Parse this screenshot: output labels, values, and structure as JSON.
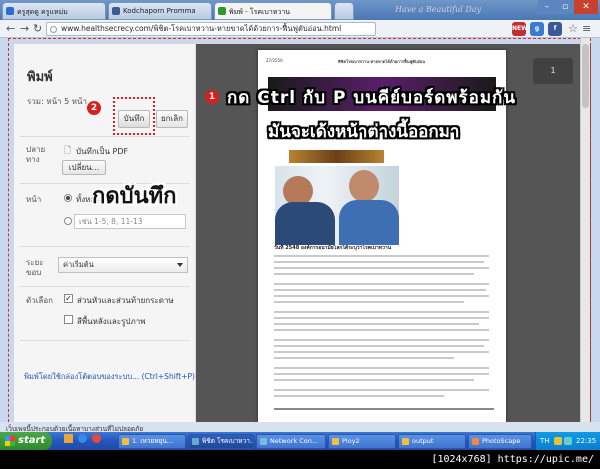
{
  "browser": {
    "tabs": [
      {
        "label": "ครูสุดดู ครูแหม่ม"
      },
      {
        "label": "Kodchaporn Promma"
      },
      {
        "label": "พิมพ์ - โรคเบาหวาน"
      }
    ],
    "deco_text": "Have a Beautiful Day",
    "url": "www.healthsecrecy.com/พิชิต-โรคเบาหวาน-หายขาดได้ด้วยการ-ฟื้นฟูตับอ่อน.html",
    "ext_icons": [
      "NEW",
      "g",
      "f"
    ],
    "colors": {
      "accent": "#d81f1f",
      "link": "#2255bb"
    }
  },
  "print": {
    "title": "พิมพ์",
    "total_label": "รวม:",
    "total_value": "หน้า 5 หน้า",
    "save_button": "บันทึก",
    "cancel_button": "ยกเลิก",
    "destination_label": "ปลายทาง",
    "destination_value": "บันทึกเป็น PDF",
    "change_button": "เปลี่ยน...",
    "pages_label": "หน้า",
    "pages_all": "ทั้งหมด",
    "pages_placeholder": "เช่น 1-5, 8, 11-13",
    "margins_label": "ระยะขอบ",
    "margins_value": "ค่าเริ่มต้น",
    "options_label": "ตัวเลือก",
    "option_headers": "ส่วนหัวและส่วนท้ายกระดาษ",
    "option_bg": "สีพื้นหลังและรูปภาพ",
    "system_link": "พิมพ์โดยใช้กล่องโต้ตอบของระบบ... (Ctrl+Shift+P)"
  },
  "annotations": {
    "badge1": "1",
    "badge2": "2",
    "line1": "กด Ctrl กับ P บนคีย์บอร์ดพร้อมกัน",
    "line2": "มันจะเด้งหน้าต่างนี้ออกมา",
    "save_hint": "กดบันทึก"
  },
  "preview": {
    "page_count": "1",
    "heading": "พิชิตโรคเบาหวาน-หายขาดได้ด้วยการฟื้นฟูตับอ่อน",
    "section": "วันที่ 2548 องค์การอนามัยโลกได้ระบุว่าโรคเบาหวาน"
  },
  "footer": {
    "status": "เว็บเพจนี้ประกอบด้วยเนื้อหาบางส่วนที่ไม่ปลอดภัย"
  },
  "taskbar": {
    "start": "start",
    "tasks": [
      "1. เหวยหยุน...",
      "พิชิต โรคเบาหวา...",
      "Network Con...",
      "Ploy2",
      "output",
      "PhotoScape"
    ],
    "lang": "TH",
    "clock": "22:35"
  },
  "credit": "[1024x768] https://upic.me/"
}
